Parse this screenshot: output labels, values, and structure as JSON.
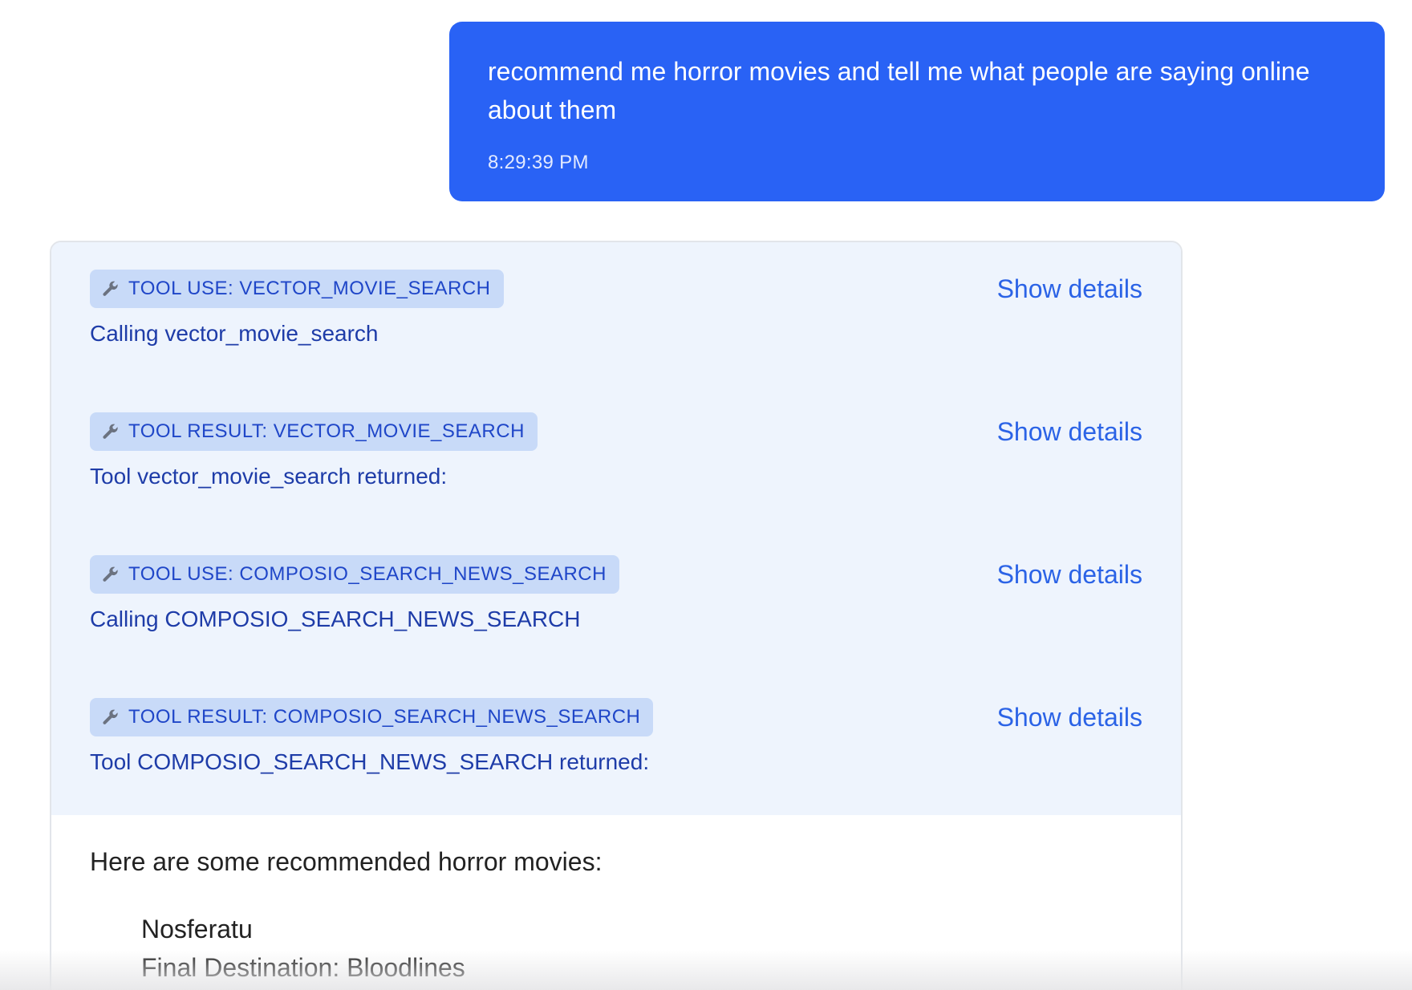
{
  "user_message": {
    "text": "recommend me horror movies and tell me what people are saying online about them",
    "time": "8:29:39 PM"
  },
  "tools": [
    {
      "badge": "TOOL USE: VECTOR_MOVIE_SEARCH",
      "description": "Calling vector_movie_search",
      "action": "Show details"
    },
    {
      "badge": "TOOL RESULT: VECTOR_MOVIE_SEARCH",
      "description": "Tool vector_movie_search returned:",
      "action": "Show details"
    },
    {
      "badge": "TOOL USE: COMPOSIO_SEARCH_NEWS_SEARCH",
      "description": "Calling COMPOSIO_SEARCH_NEWS_SEARCH",
      "action": "Show details"
    },
    {
      "badge": "TOOL RESULT: COMPOSIO_SEARCH_NEWS_SEARCH",
      "description": "Tool COMPOSIO_SEARCH_NEWS_SEARCH returned:",
      "action": "Show details"
    }
  ],
  "answer": {
    "intro": "Here are some recommended horror movies:",
    "movies": [
      "Nosferatu",
      "Final Destination: Bloodlines"
    ]
  },
  "icons": {
    "tool_badge": "wrench-icon"
  },
  "colors": {
    "user_bubble": "#2962f5",
    "tool_section_bg": "#eef4fd",
    "badge_bg": "#c8daf8",
    "link": "#2b63e6"
  }
}
